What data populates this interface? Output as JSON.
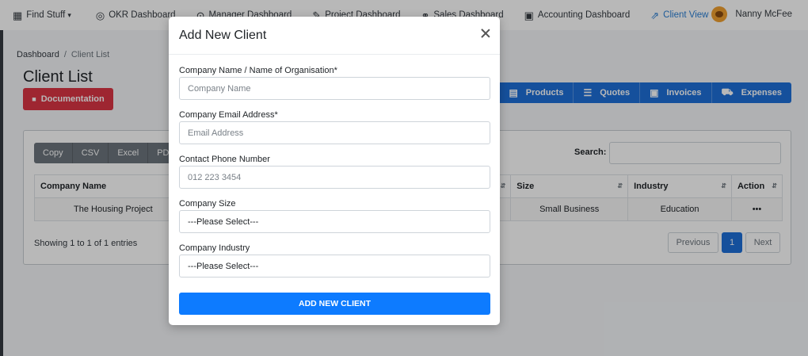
{
  "nav": {
    "items": [
      {
        "icon": "grid-icon",
        "label": "Find Stuff"
      },
      {
        "icon": "target-icon",
        "label": "OKR Dashboard"
      },
      {
        "icon": "location-icon",
        "label": "Manager Dashboard"
      },
      {
        "icon": "edit-icon",
        "label": "Project Dashboard"
      },
      {
        "icon": "handshake-icon",
        "label": "Sales Dashboard"
      },
      {
        "icon": "money-icon",
        "label": "Accounting Dashboard"
      },
      {
        "icon": "share-icon",
        "label": "Client View"
      }
    ],
    "active_color": "#2a7fd4",
    "user": "Nanny McFee"
  },
  "breadcrumb": {
    "home": "Dashboard",
    "separator": "/",
    "current": "Client List"
  },
  "page": {
    "title": "Client List",
    "documentation_label": "Documentation",
    "actions": [
      "Products",
      "Quotes",
      "Invoices",
      "Expenses"
    ]
  },
  "table": {
    "export_buttons": [
      "Copy",
      "CSV",
      "Excel",
      "PDF"
    ],
    "search_label": "Search:",
    "headers": [
      "Company Name",
      "",
      "Size",
      "Industry",
      "Action"
    ],
    "row": {
      "company": "The Housing Project",
      "size": "Small Business",
      "industry": "Education",
      "action": "•••"
    },
    "showing": "Showing 1 to 1 of 1 entries",
    "pager": {
      "previous": "Previous",
      "page": "1",
      "next": "Next"
    }
  },
  "modal": {
    "title": "Add New Client",
    "fields": {
      "company_name": {
        "label": "Company Name / Name of Organisation*",
        "placeholder": "Company Name"
      },
      "email": {
        "label": "Company Email Address*",
        "placeholder": "Email Address"
      },
      "phone": {
        "label": "Contact Phone Number",
        "placeholder": "012 223 3454"
      },
      "size": {
        "label": "Company Size",
        "value": "---Please Select---"
      },
      "industry": {
        "label": "Company Industry",
        "value": "---Please Select---"
      }
    },
    "submit_label": "ADD NEW CLIENT"
  }
}
